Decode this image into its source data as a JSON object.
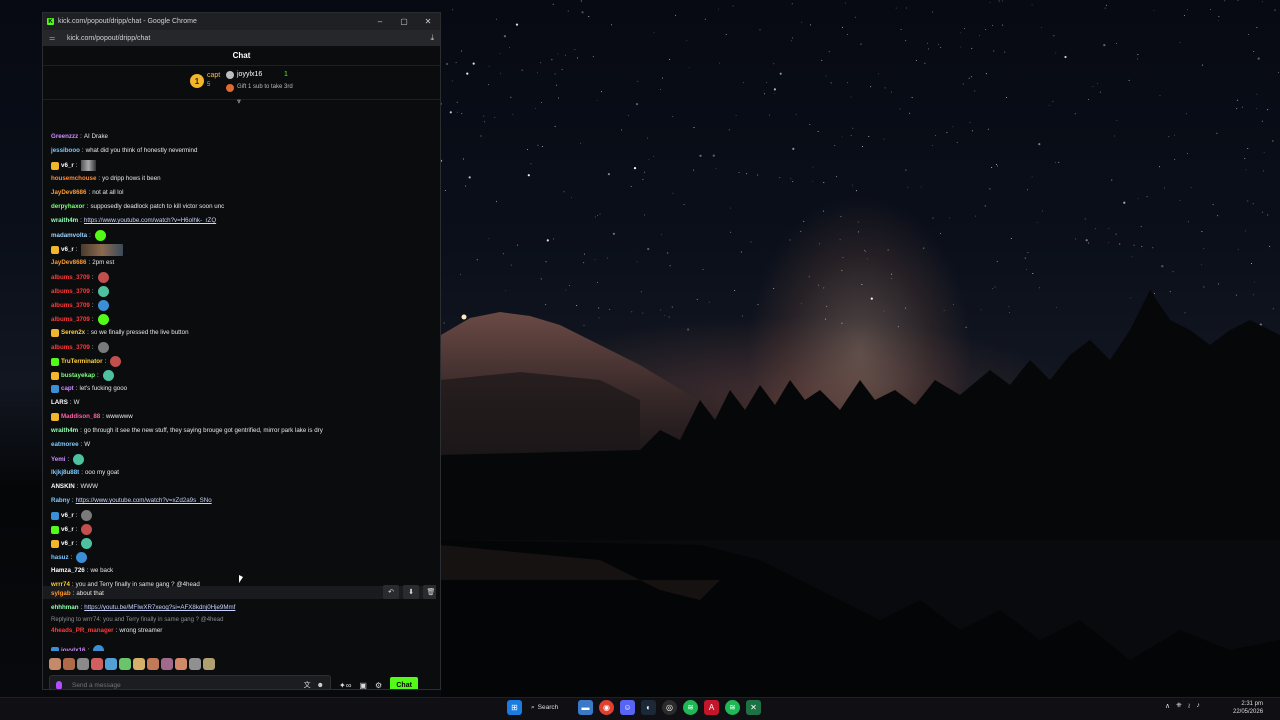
{
  "window": {
    "title": "kick.com/popout/dripp/chat - Google Chrome",
    "url": "kick.com/popout/dripp/chat",
    "favicon": "K"
  },
  "chat": {
    "header": "Chat",
    "top_gifter": {
      "rank": "1",
      "name": "capt",
      "count": "5"
    },
    "second_gifter": {
      "name": "joyylx16",
      "count": "1"
    },
    "gift_prompt": "Gift 1 sub to take 3rd",
    "messages": [
      {
        "user": "Greenzzz",
        "text": "AI Drake",
        "color": "#d18cff"
      },
      {
        "user": "jessibooo",
        "text": "what did you think of honestly nevermind",
        "color": "#7ec8ff"
      },
      {
        "user": "v6_r",
        "text": "",
        "color": "#ffffff"
      },
      {
        "user": "housemchouse",
        "text": "yo dripp hows it been",
        "color": "#ff8c3a"
      },
      {
        "user": "JayDev8686",
        "text": "not at all lol",
        "color": "#ff9a2a"
      },
      {
        "user": "derpyhaxor",
        "text": "supposedly deadlock patch to kill victor soon unc",
        "color": "#7cff7c"
      },
      {
        "user": "wraith4m",
        "text": "https://www.youtube.com/watch?v=H6olhk-_rZQ",
        "color": "#8fffb0"
      },
      {
        "user": "madamvolta",
        "text": "",
        "color": "#9ad3ff"
      },
      {
        "user": "v6_r",
        "text": "",
        "color": "#ffffff"
      },
      {
        "user": "JayDev8686",
        "text": "2pm est",
        "color": "#ff9a2a"
      },
      {
        "user": "albums_3709",
        "text": "",
        "color": "#ff3b3b"
      },
      {
        "user": "albums_3709",
        "text": "",
        "color": "#ff3b3b"
      },
      {
        "user": "albums_3709",
        "text": "",
        "color": "#ff3b3b"
      },
      {
        "user": "albums_3709",
        "text": "",
        "color": "#ff3b3b"
      },
      {
        "user": "Seren2x",
        "text": "so we finally pressed the live button",
        "color": "#ffd23b"
      },
      {
        "user": "albums_3709",
        "text": "",
        "color": "#ff3b3b"
      },
      {
        "user": "TruTerminator",
        "text": "",
        "color": "#ffd23b"
      },
      {
        "user": "bustayekap",
        "text": "",
        "color": "#7cff7c"
      },
      {
        "user": "capt",
        "text": "let's fucking gooo",
        "color": "#d18cff"
      },
      {
        "user": "LARS",
        "text": "W",
        "color": "#ffffff"
      },
      {
        "user": "Maddison_88",
        "text": "wwwwww",
        "color": "#ff5fa8"
      },
      {
        "user": "wraith4m",
        "text": "go through it see the new stuff, they saying brouge got gentrified, mirror park lake is dry",
        "color": "#8fffb0"
      },
      {
        "user": "eatmoree",
        "text": "W",
        "color": "#7ec8ff"
      },
      {
        "user": "Yemi",
        "text": "",
        "color": "#d18cff"
      },
      {
        "user": "lkjkj8u88t",
        "text": "ooo my goat",
        "color": "#7ec8ff"
      },
      {
        "user": "ANSKIN",
        "text": "WWW",
        "color": "#ffffff"
      },
      {
        "user": "Rabny",
        "text": "https://www.youtube.com/watch?v=xZd2a9s_SNo",
        "color": "#7ec8ff"
      },
      {
        "user": "v6_r",
        "text": "",
        "color": "#ffffff"
      },
      {
        "user": "v6_r",
        "text": "",
        "color": "#ffffff"
      },
      {
        "user": "v6_r",
        "text": "",
        "color": "#ffffff"
      },
      {
        "user": "hasuz",
        "text": "",
        "color": "#7ec8ff"
      },
      {
        "user": "Hamza_726",
        "text": "we back",
        "color": "#ffffff"
      },
      {
        "user": "wrrr74",
        "text": "you and Terry finally in same gang ? @4head",
        "color": "#ffd23b"
      },
      {
        "user": "sylgab",
        "text": "about that",
        "color": "#ff9a2a"
      },
      {
        "user": "ehhhman",
        "text": "https://youtu.be/MFIwXR7xeog?si=AFX8kdnj0Hje9Mmf",
        "color": "#8fffb0"
      },
      {
        "user": "4heads_PR_manager",
        "text": "wrong streamer",
        "color": "#ff3b3b"
      },
      {
        "user": "joyylx16",
        "text": "",
        "color": "#d18cff"
      }
    ],
    "reply_preview": "Replying to wrrr74: you and Terry finally in same gang ? @4head",
    "input_placeholder": "Send a message",
    "send_label": "Chat"
  },
  "taskbar": {
    "search_label": "Search",
    "time": "2:31 pm",
    "date": "22/05/2026"
  },
  "colors": {
    "kick_green": "#53fc18"
  }
}
